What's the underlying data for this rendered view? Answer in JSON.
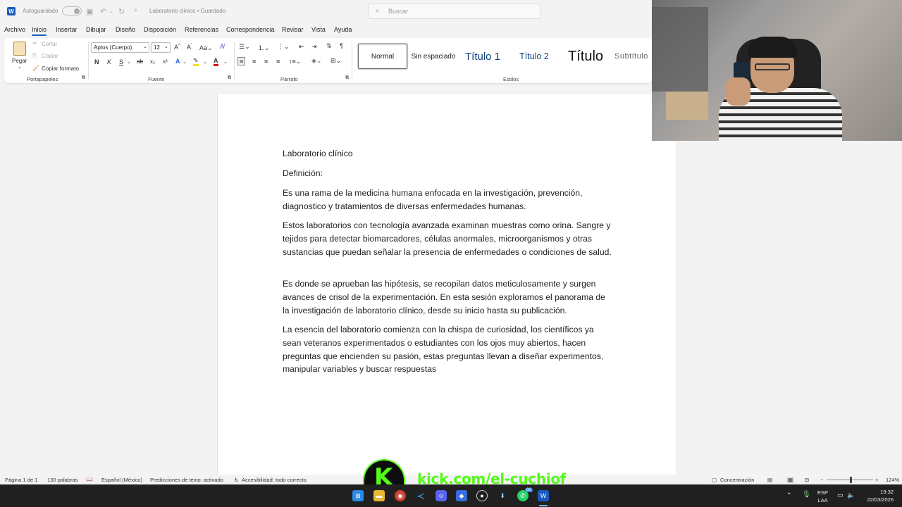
{
  "app": {
    "autosave_label": "Autoguardado",
    "doc_title": "Laboratorio clínico • Guardado",
    "search_placeholder": "Buscar"
  },
  "menu": [
    "Archivo",
    "Inicio",
    "Insertar",
    "Dibujar",
    "Diseño",
    "Disposición",
    "Referencias",
    "Correspondencia",
    "Revisar",
    "Vista",
    "Ayuda"
  ],
  "ribbon": {
    "clipboard": {
      "paste": "Pegar",
      "cut": "Cortar",
      "copy": "Copiar",
      "format_painter": "Copiar formato",
      "group": "Portapapeles"
    },
    "font": {
      "name": "Aptos (Cuerpo)",
      "size": "12",
      "bold": "N",
      "italic": "K",
      "underline": "S",
      "group": "Fuente"
    },
    "paragraph": {
      "group": "Párrafo"
    },
    "styles": {
      "items": [
        "Normal",
        "Sin espaciado",
        "Título 1",
        "Título 2",
        "Título",
        "Subtítulo"
      ],
      "group": "Estilos"
    }
  },
  "document": {
    "paragraphs": [
      "Laboratorio clínico",
      "Definición:",
      "Es una rama de la medicina humana enfocada en la investigación, prevención, diagnostico y tratamientos de diversas enfermedades humanas.",
      "Estos laboratorios con tecnología avanzada examinan muestras como orina. Sangre y tejidos para detectar biomarcadores, células anormales, microorganismos y otras sustancias que puedan señalar la presencia de enfermedades o condiciones de salud.",
      "Es donde se aprueban las hipótesis, se recopilan datos meticulosamente y surgen avances de crisol de la experimentación. En esta sesión exploramos el panorama de la investigación de laboratorio clínico, desde su inicio hasta su publicación.",
      "La esencia del laboratorio comienza con la chispa de curiosidad, los científicos ya sean veteranos experimentados o estudiantes con los ojos muy abiertos, hacen preguntas que encienden su pasión, estas preguntas llevan a diseñar experimentos, manipular variables y buscar respuestas"
    ]
  },
  "status": {
    "page": "Página 1 de 1",
    "words": "130 palabras",
    "language": "Español (México)",
    "predictions": "Predicciones de texto: activado",
    "accessibility": "Accesibilidad: todo correcto",
    "focus": "Concentración",
    "zoom": "124%"
  },
  "overlay": {
    "kick_url": "kick.com/el-cuchiof",
    "kick_letter": "K"
  },
  "taskbar": {
    "lang_top": "ESP",
    "lang_bottom": "LAA",
    "time": "19:32",
    "date": "22/03/2026",
    "whatsapp_badge": "60"
  },
  "colors": {
    "word_blue": "#185abd",
    "kick_green": "#53fc18"
  }
}
